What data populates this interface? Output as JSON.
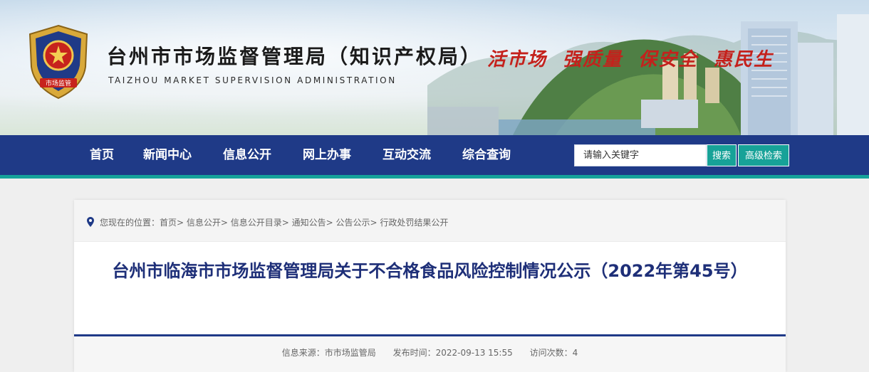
{
  "header": {
    "title": "台州市市场监督管理局（知识产权局）",
    "subtitle": "TAIZHOU MARKET SUPERVISION ADMINISTRATION",
    "slogans": [
      "活市场",
      "强质量",
      "保安全",
      "惠民生"
    ],
    "emblem_text": "市场监管"
  },
  "nav": {
    "items": [
      "首页",
      "新闻中心",
      "信息公开",
      "网上办事",
      "互动交流",
      "综合查询"
    ],
    "search_placeholder": "请输入关键字",
    "search_button": "搜索",
    "advanced_button": "高级检索"
  },
  "breadcrumb": {
    "prefix": "您现在的位置：",
    "trail": "首页> 信息公开> 信息公开目录> 通知公告> 公告公示> 行政处罚结果公开"
  },
  "article": {
    "title": "台州市临海市市场监督管理局关于不合格食品风险控制情况公示（2022年第45号）",
    "source": "信息来源：市市场监管局",
    "published": "发布时间：2022-09-13 15:55",
    "views": "访问次数：4"
  },
  "colors": {
    "nav_bg": "#1f3a87",
    "accent_teal": "#17a298",
    "slogan_red": "#c4211c",
    "title_blue": "#1e2f78"
  }
}
